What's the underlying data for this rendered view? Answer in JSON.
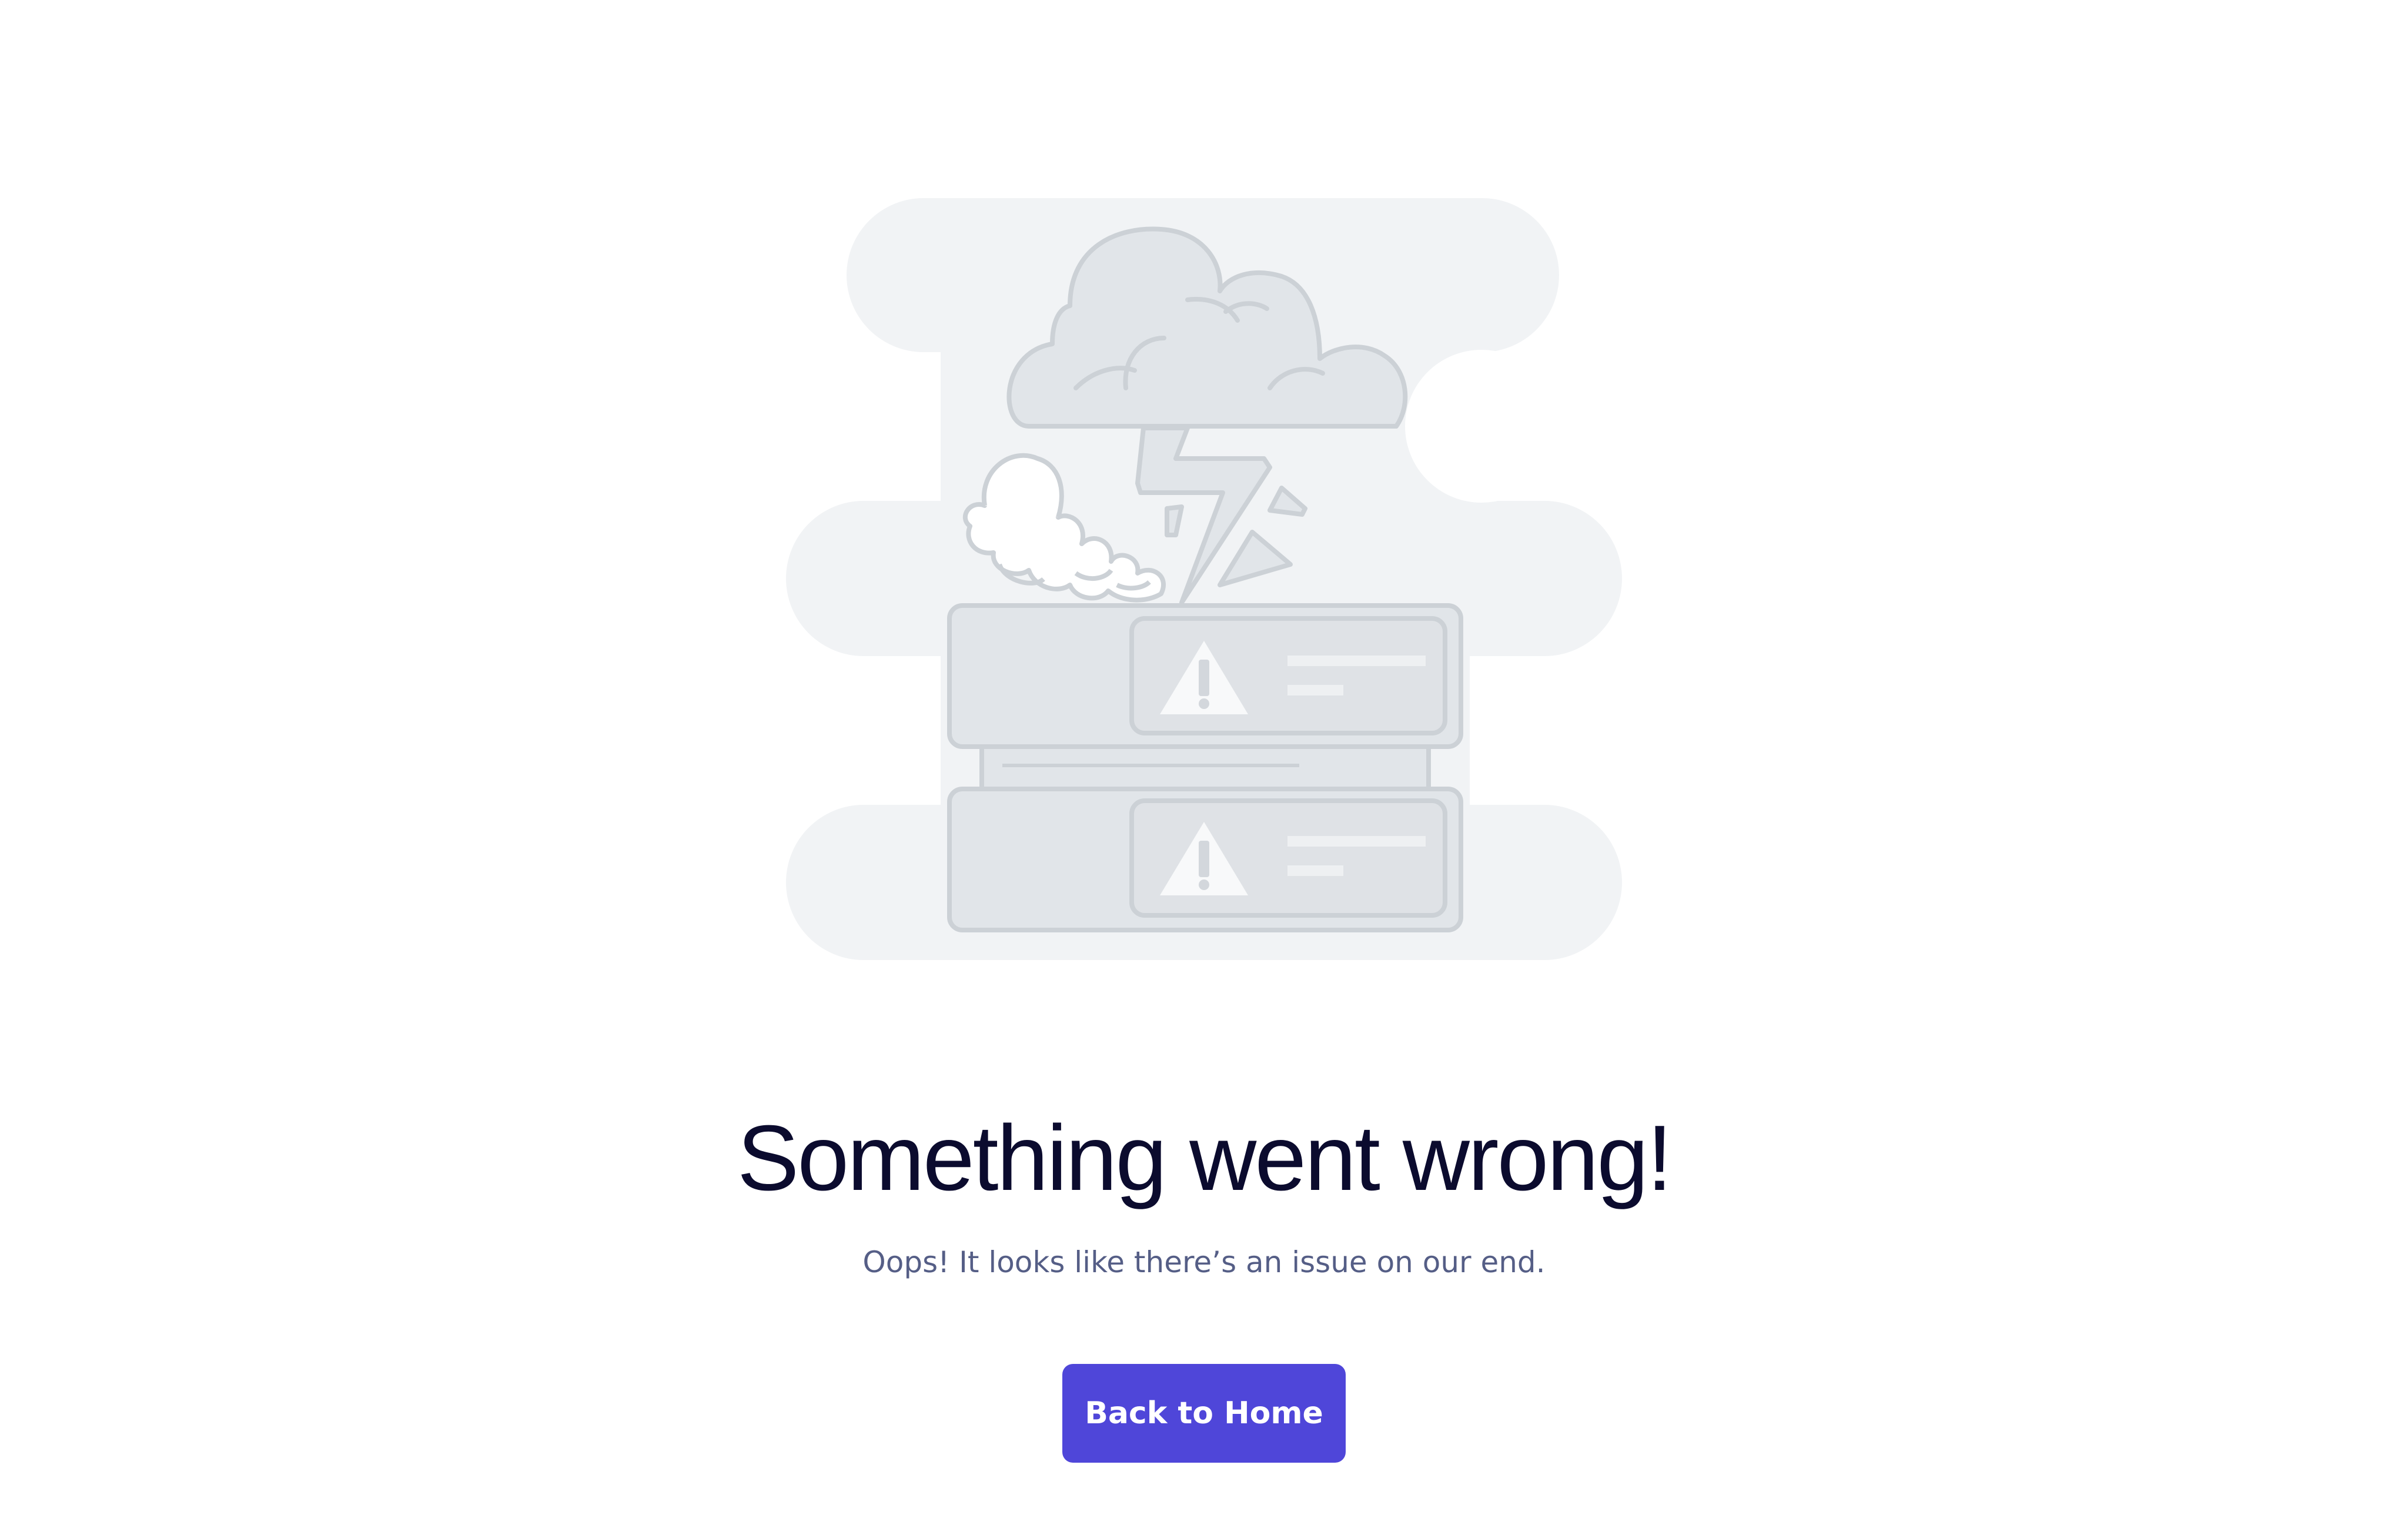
{
  "error": {
    "title": "Something went wrong!",
    "subtitle": "Oops! It looks like there’s an issue on our end.",
    "button_label": "Back to Home"
  },
  "illustration": {
    "subject": "server-storm-illustration",
    "icons": [
      "cloud-icon",
      "lightning-icon",
      "smoke-icon",
      "server-icon",
      "warning-icon"
    ]
  },
  "colors": {
    "background": "#ffffff",
    "blob": "#f1f3f5",
    "illustration_fill": "#e1e5e9",
    "illustration_stroke": "#ccd1d6",
    "title": "#0b0b2e",
    "subtitle": "#555e86",
    "button": "#4f46d9",
    "button_text": "#ffffff"
  }
}
